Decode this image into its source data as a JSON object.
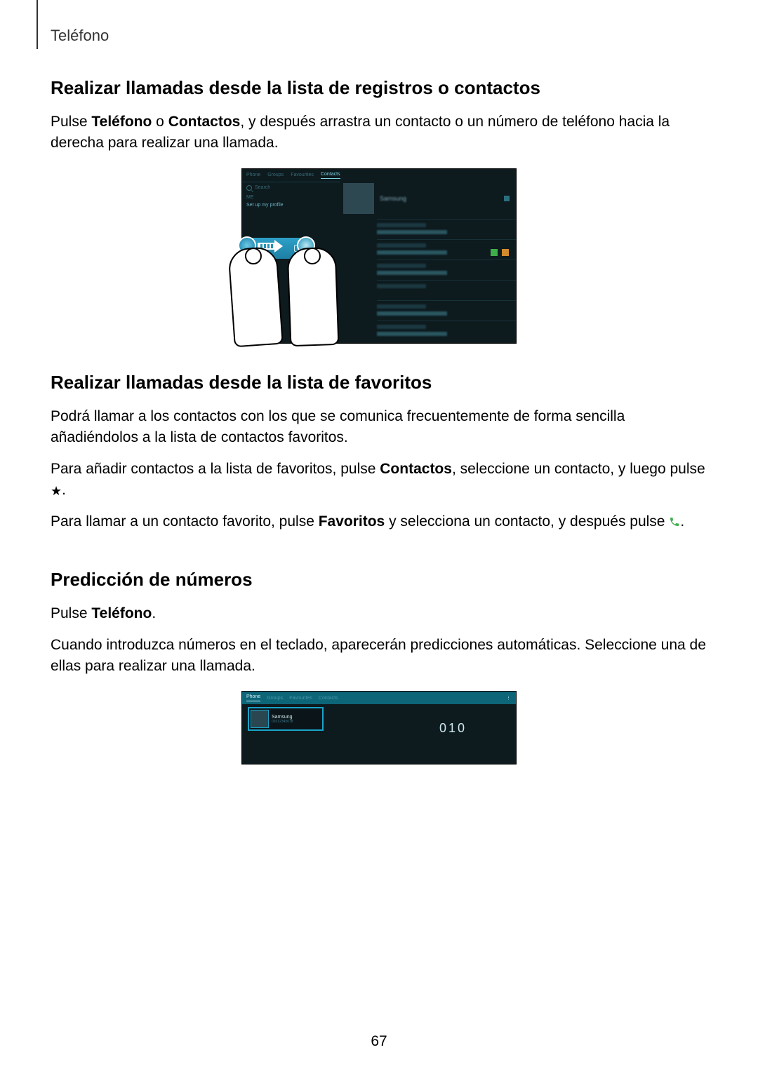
{
  "header": {
    "section": "Teléfono"
  },
  "s1": {
    "heading": "Realizar llamadas desde la lista de registros o contactos",
    "p1a": "Pulse ",
    "p1b": "Teléfono",
    "p1c": " o ",
    "p1d": "Contactos",
    "p1e": ", y después arrastra un contacto o un número de teléfono hacia la derecha para realizar una llamada."
  },
  "fig1": {
    "tab_phone": "Phone",
    "tab_groups": "Groups",
    "tab_fav": "Favourites",
    "tab_contacts": "Contacts",
    "search_ph": "Search",
    "me": "ME",
    "setup": "Set up my profile",
    "contact_name": "Samsung"
  },
  "s2": {
    "heading": "Realizar llamadas desde la lista de favoritos",
    "p1": "Podrá llamar a los contactos con los que se comunica frecuentemente de forma sencilla añadiéndolos a la lista de contactos favoritos.",
    "p2a": "Para añadir contactos a la lista de favoritos, pulse ",
    "p2b": "Contactos",
    "p2c": ", seleccione un contacto, y luego pulse ",
    "p2d": ".",
    "p3a": "Para llamar a un contacto favorito, pulse ",
    "p3b": "Favoritos",
    "p3c": " y selecciona un contacto, y después pulse ",
    "p3d": "."
  },
  "s3": {
    "heading": "Predicción de números",
    "p1a": "Pulse ",
    "p1b": "Teléfono",
    "p1c": ".",
    "p2": "Cuando introduzca números en el teclado, aparecerán predicciones automáticas. Seleccione una de ellas para realizar una llamada."
  },
  "fig2": {
    "tab_phone": "Phone",
    "tab_groups": "Groups",
    "tab_fav": "Favourites",
    "tab_contacts": "Contacts",
    "pred_name": "Samsung",
    "pred_number": "01012345678",
    "dial": "010"
  },
  "page_number": "67"
}
